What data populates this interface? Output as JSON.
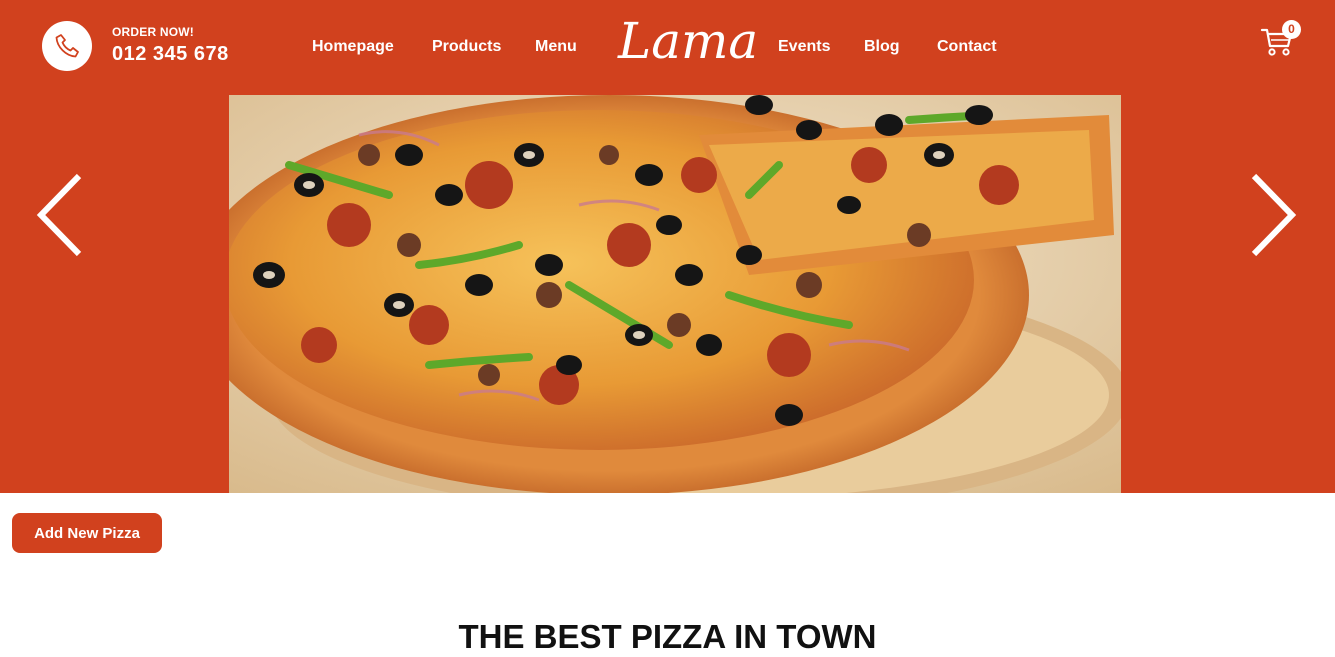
{
  "header": {
    "order_label": "ORDER NOW!",
    "phone_number": "012 345 678",
    "logo_text": "Lama",
    "nav": {
      "homepage": "Homepage",
      "products": "Products",
      "menu": "Menu",
      "events": "Events",
      "blog": "Blog",
      "contact": "Contact"
    },
    "cart_count": "0",
    "icons": {
      "phone": "phone-icon",
      "cart": "cart-icon"
    }
  },
  "slider": {
    "image": "pizza-image",
    "prev": "arrow-left-icon",
    "next": "arrow-right-icon"
  },
  "actions": {
    "add_pizza_label": "Add New Pizza"
  },
  "main": {
    "headline": "THE BEST PIZZA IN TOWN"
  },
  "colors": {
    "brand": "#d1411e",
    "text_dark": "#111111",
    "background": "#ffffff"
  }
}
